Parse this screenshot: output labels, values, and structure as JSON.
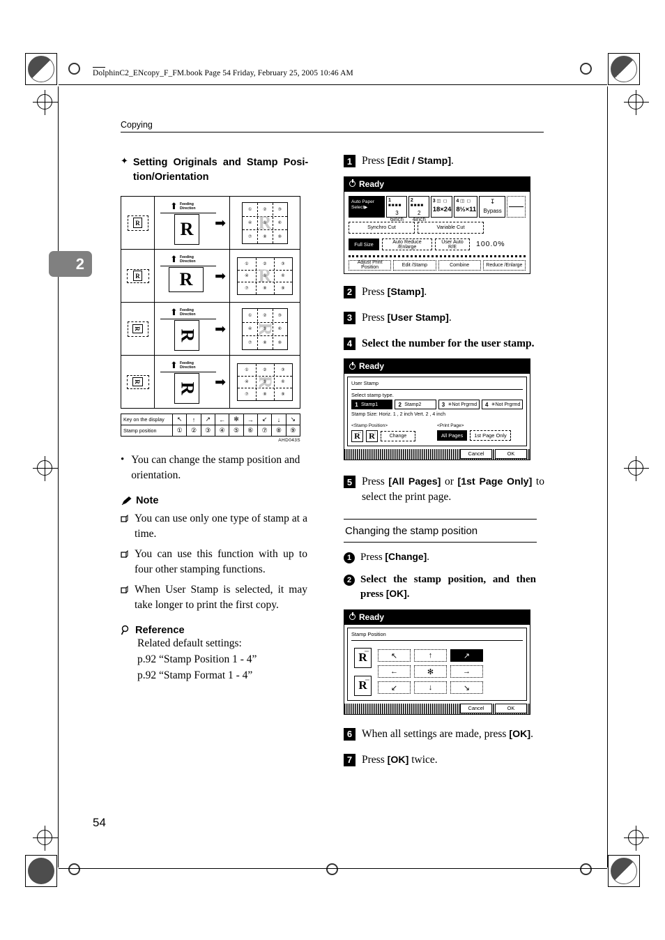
{
  "running_head": {
    "file_info": "DolphinC2_ENcopy_F_FM.book   Page 54  Friday, February 25, 2005  10:46 AM",
    "chapter_label": "Copying",
    "chapter_tab": "2",
    "page_number": "54"
  },
  "left": {
    "section_heading": "Setting Originals and Stamp Posi-tion/Orientation",
    "diagram": {
      "feeding_label": "Feeding\nDirection",
      "rows": [
        {
          "orig": "R",
          "sheet": "R",
          "ghost": "R",
          "cells": [
            "①",
            "②",
            "③",
            "④",
            "⑤",
            "⑥",
            "⑦",
            "⑧",
            "⑨"
          ],
          "corner": "Ⓡ"
        },
        {
          "orig": "R",
          "sheet": "R",
          "ghost": "R",
          "cells": [
            "①",
            "②",
            "③",
            "④",
            "⑤",
            "⑥",
            "⑦",
            "⑧",
            "⑨"
          ],
          "corner": "Ⓡ"
        },
        {
          "orig": "R",
          "sheet": "R",
          "ghost": "R",
          "cells": [
            "①",
            "②",
            "③",
            "④",
            "⑤",
            "⑥",
            "⑦",
            "⑧",
            "⑨"
          ],
          "corner": "Ⓡ"
        },
        {
          "orig": "R",
          "sheet": "R",
          "ghost": "R",
          "cells": [
            "①",
            "②",
            "③",
            "④",
            "⑤",
            "⑥",
            "⑦",
            "⑧",
            "⑨"
          ],
          "corner": "Ⓡ"
        }
      ],
      "legend": {
        "row1_label": "Key on the display",
        "row2_label": "Stamp position",
        "keys": [
          "↖",
          "↑",
          "↗",
          "←",
          "✻",
          "→",
          "↙",
          "↓",
          "↘"
        ],
        "positions": [
          "①",
          "②",
          "③",
          "④",
          "⑤",
          "⑥",
          "⑦",
          "⑧",
          "⑨"
        ]
      },
      "figure_ref": "AHD043S"
    },
    "bullet": "You can change the stamp position and orientation.",
    "note": {
      "label": "Note",
      "items": [
        "You can use only one type of stamp at a time.",
        "You can use this function with up to four other stamping functions.",
        "When User Stamp is selected, it may take longer to print the first copy."
      ]
    },
    "reference": {
      "label": "Reference",
      "intro": "Related default settings:",
      "links": [
        "p.92 “Stamp Position 1 - 4”",
        "p.92 “Stamp Format 1 - 4”"
      ]
    }
  },
  "right": {
    "steps": [
      {
        "num": "1",
        "text_before": "Press ",
        "key": "[Edit / Stamp]",
        "text_after": "."
      },
      {
        "num": "2",
        "text_before": "Press ",
        "key": "[Stamp]",
        "text_after": "."
      },
      {
        "num": "3",
        "text_before": "Press ",
        "key": "[User Stamp]",
        "text_after": "."
      },
      {
        "num": "4",
        "text_before": "Select the number for the user stamp.",
        "key": "",
        "text_after": ""
      },
      {
        "num": "5",
        "text_before": "Press ",
        "key": "[All Pages]",
        "mid": " or ",
        "key2": "[1st Page Only]",
        "text_after": " to select the print page."
      },
      {
        "num": "6",
        "text_before": "When all settings are made, press ",
        "key": "[OK]",
        "text_after": "."
      },
      {
        "num": "7",
        "text_before": "Press ",
        "key": "[OK]",
        "text_after": " twice."
      }
    ],
    "subsection": {
      "title": "Changing the stamp position",
      "substeps": [
        {
          "num": "1",
          "text_before": "Press ",
          "key": "[Change]",
          "text_after": "."
        },
        {
          "num": "2",
          "text_before": "Select the stamp position, and then press ",
          "key": "[OK]",
          "text_after": "."
        }
      ]
    },
    "lcd_main": {
      "status": "Ready",
      "auto_paper_select": "Auto Paper Select▶",
      "trays": [
        {
          "num": "1",
          "size": "3 6inch",
          "roll": true
        },
        {
          "num": "2",
          "size": "2 4inch",
          "roll": true
        },
        {
          "num": "3",
          "size": "18×24",
          "sheet": true
        },
        {
          "num": "4",
          "size": "8½×11",
          "sheet": true
        },
        {
          "num": "",
          "size": "Bypass",
          "bypass": true
        }
      ],
      "cut_buttons": [
        "Synchro Cut",
        "Variable Cut"
      ],
      "zoom_buttons": [
        "Full Size",
        "Auto Reduce /Enlarge",
        "User Auto R/E"
      ],
      "zoom_value": "100.0%",
      "tabs": [
        "Adjust Print Position",
        "Edit /Stamp",
        "Combine",
        "Reduce /Enlarge"
      ]
    },
    "lcd_user_stamp": {
      "status": "Ready",
      "panel_title": "User Stamp",
      "prompt": "Select stamp type.",
      "stamps": [
        {
          "idx": "1",
          "label": "Stamp1",
          "selected": true
        },
        {
          "idx": "2",
          "label": "Stamp2",
          "selected": false
        },
        {
          "idx": "3",
          "label": "✳Not Prgrmd",
          "selected": false,
          "dim": true
        },
        {
          "idx": "4",
          "label": "✳Not Prgrmd",
          "selected": false,
          "dim": true
        }
      ],
      "stamp_size": "Stamp Size: Horiz.    1 , 2  inch Vert.    2 , 4  inch",
      "stamp_position_caption": "<Stamp Position>",
      "change_button": "Change",
      "print_page_caption": "<Print Page>",
      "print_page_buttons": [
        {
          "label": "All Pages",
          "selected": true
        },
        {
          "label": "1st Page Only",
          "selected": false
        }
      ],
      "cancel": "Cancel",
      "ok": "OK"
    },
    "lcd_stamp_position": {
      "status": "Ready",
      "panel_title": "Stamp Position",
      "arrows": [
        {
          "glyph": "↖",
          "selected": false
        },
        {
          "glyph": "↑",
          "selected": false
        },
        {
          "glyph": "↗",
          "selected": true
        },
        {
          "glyph": "←",
          "selected": false
        },
        {
          "glyph": "✻",
          "selected": false
        },
        {
          "glyph": "→",
          "selected": false
        },
        {
          "glyph": "↙",
          "selected": false
        },
        {
          "glyph": "↓",
          "selected": false
        },
        {
          "glyph": "↘",
          "selected": false
        }
      ],
      "cancel": "Cancel",
      "ok": "OK"
    }
  }
}
